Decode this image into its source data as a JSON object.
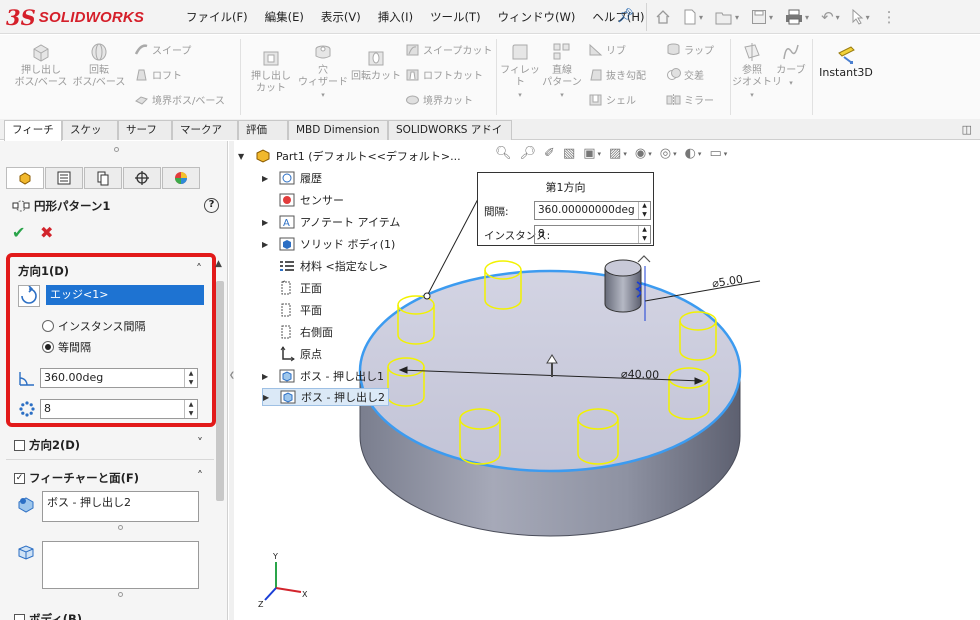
{
  "app": {
    "brand_ds": "3S",
    "brand_name": "SOLIDWORKS"
  },
  "menu": [
    "ファイル(F)",
    "編集(E)",
    "表示(V)",
    "挿入(I)",
    "ツール(T)",
    "ウィンドウ(W)",
    "ヘルプ(H)"
  ],
  "ribbon": {
    "extrude_boss": "押し出し\nボス/ベース",
    "revolve_boss": "回転\nボス/ベース",
    "sweep": "スイープ",
    "loft": "ロフト",
    "boundary_boss": "境界ボス/ベース",
    "extrude_cut": "押し出し\nカット",
    "hole_wizard": "穴\nウィザード",
    "revolve_cut": "回転カット",
    "sweep_cut": "スイープカット",
    "loft_cut": "ロフトカット",
    "boundary_cut": "境界カット",
    "fillet": "フィレット",
    "linear_pattern": "直線\nパターン",
    "rib": "リブ",
    "draft": "抜き勾配",
    "shell": "シェル",
    "wrap": "ラップ",
    "intersect": "交差",
    "mirror": "ミラー",
    "ref_geometry": "参照\nジオメトリ",
    "curves": "カーブ",
    "instant3d": "Instant3D"
  },
  "tabs": [
    "フィーチャー",
    "スケッチ",
    "サーフェス",
    "マークアップ",
    "評価",
    "MBD Dimension",
    "SOLIDWORKS アドイン"
  ],
  "property_manager": {
    "title": "円形パターン1",
    "help": "?",
    "direction1": {
      "header": "方向1(D)",
      "edge_value": "エッジ<1>",
      "radio_instance_spacing": "インスタンス間隔",
      "radio_equal_spacing": "等間隔",
      "angle_value": "360.00deg",
      "count_value": "8"
    },
    "direction2": {
      "header": "方向2(D)"
    },
    "features_faces": {
      "header": "フィーチャーと面(F)",
      "feature_item": "ボス - 押し出し2"
    },
    "bodies_header": "ボディ(B)"
  },
  "tree": {
    "root": "Part1 (デフォルト<<デフォルト>...",
    "items": [
      "履歴",
      "センサー",
      "アノテート アイテム",
      "ソリッド ボディ(1)",
      "材料 <指定なし>",
      "正面",
      "平面",
      "右側面",
      "原点",
      "ボス - 押し出し1",
      "ボス - 押し出し2"
    ]
  },
  "callout": {
    "title": "第1方向",
    "spacing_label": "間隔:",
    "spacing_value": "360.00000000deg",
    "instances_label": "インスタンス:",
    "instances_value": "8"
  },
  "dimensions": {
    "small_dia": "⌀5.00",
    "large_dia": "⌀40.00"
  },
  "triad": {
    "x": "X",
    "y": "Y",
    "z": "Z"
  },
  "colors": {
    "highlight_red": "#e21a1a",
    "selection_blue": "#1e73d2",
    "preview_yellow": "#f2f200",
    "edge_blue": "#3c9bf0"
  }
}
